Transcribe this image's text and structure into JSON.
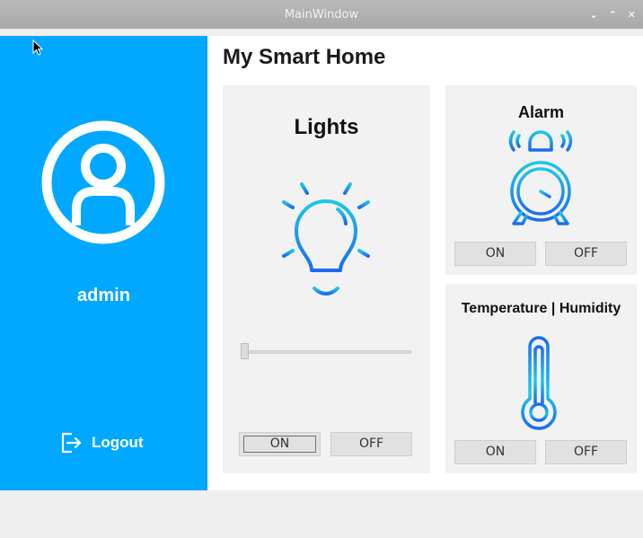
{
  "window": {
    "title": "MainWindow",
    "controls": [
      "⌄",
      "⌃",
      "✕"
    ]
  },
  "sidebar": {
    "username": "admin",
    "logout_label": "Logout"
  },
  "main": {
    "title": "My Smart Home"
  },
  "lights": {
    "title": "Lights",
    "on_label": "ON",
    "off_label": "OFF",
    "brightness": 0
  },
  "alarm": {
    "title": "Alarm",
    "on_label": "ON",
    "off_label": "OFF"
  },
  "temperature": {
    "title": "Temperature | Humidity",
    "on_label": "ON",
    "off_label": "OFF"
  },
  "colors": {
    "sidebar": "#00a8ff",
    "card": "#f2f2f2",
    "icon_gradient_start": "#1ec8e6",
    "icon_gradient_end": "#1b6cf0"
  },
  "icons": {
    "avatar": "user-circle-icon",
    "logout": "logout-icon",
    "lights": "light-bulb-icon",
    "alarm": "alarm-clock-icon",
    "temperature": "thermometer-icon"
  }
}
